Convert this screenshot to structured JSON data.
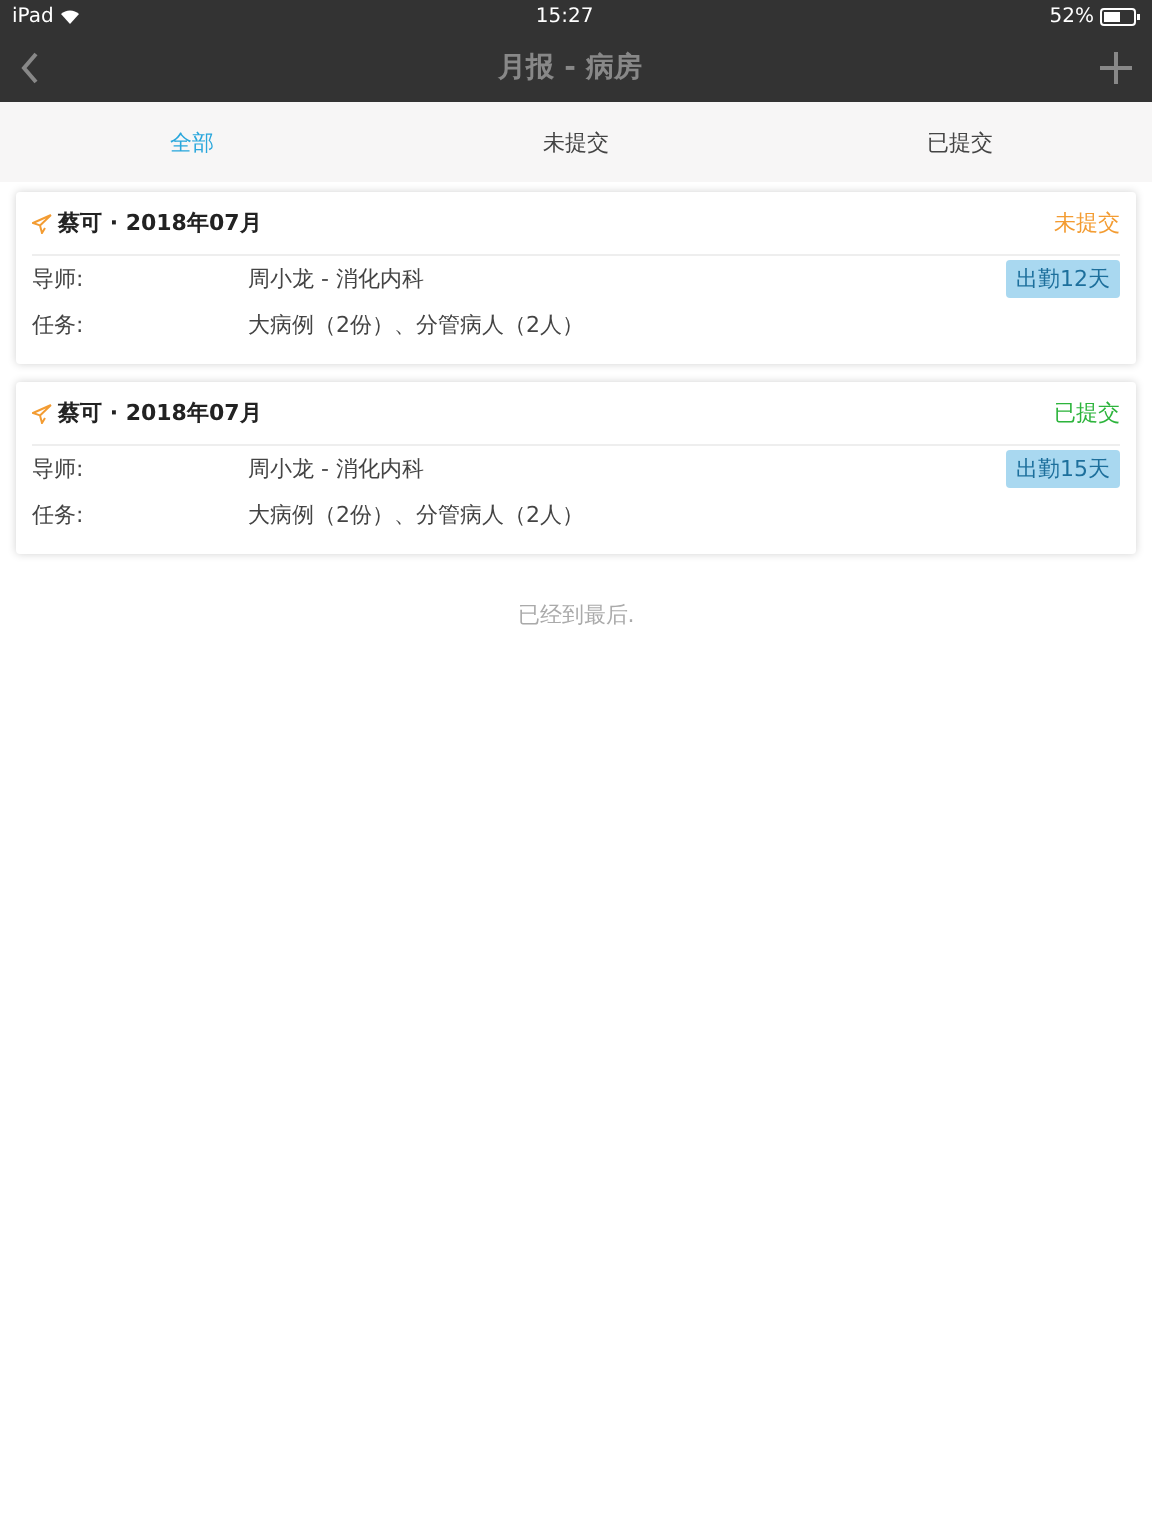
{
  "status_bar": {
    "device": "iPad",
    "time": "15:27",
    "battery": "52%"
  },
  "nav": {
    "title": "月报 - 病房"
  },
  "tabs": [
    {
      "label": "全部",
      "selected": true
    },
    {
      "label": "未提交",
      "selected": false
    },
    {
      "label": "已提交",
      "selected": false
    }
  ],
  "reports": [
    {
      "title": "蔡可 · 2018年07月",
      "status": "未提交",
      "color": "#f39c32",
      "fields": [
        {
          "label": "导师:",
          "value": "周小龙 - 消化内科",
          "badge": "出勤12天"
        },
        {
          "label": "任务:",
          "value": "大病例（2份）、分管病人（2人）"
        }
      ]
    },
    {
      "title": "蔡可 · 2018年07月",
      "status": "已提交",
      "color": "#2db43c",
      "fields": [
        {
          "label": "导师:",
          "value": "周小龙 - 消化内科",
          "badge": "出勤15天"
        },
        {
          "label": "任务:",
          "value": "大病例（2份）、分管病人（2人）"
        }
      ]
    }
  ],
  "footer": "已经到最后."
}
